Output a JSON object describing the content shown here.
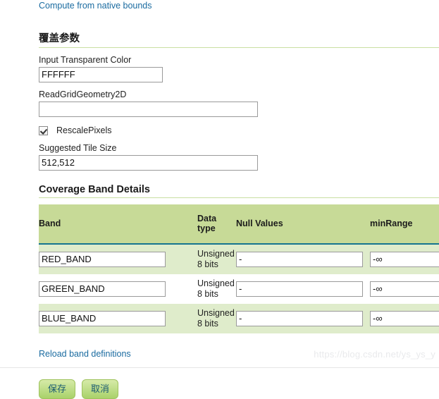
{
  "top_link": "Compute from native bounds",
  "coverage_section": {
    "heading": "覆盖参数",
    "fields": {
      "transparent_color_label": "Input Transparent Color",
      "transparent_color_value": "FFFFFF",
      "readgrid_label": "ReadGridGeometry2D",
      "readgrid_value": "",
      "rescale_label": "RescalePixels",
      "rescale_checked": true,
      "tile_size_label": "Suggested Tile Size",
      "tile_size_value": "512,512"
    }
  },
  "band_section": {
    "heading": "Coverage Band Details",
    "columns": {
      "band": "Band",
      "data_type": "Data\ntype",
      "data_type_line1": "Data",
      "data_type_line2": "type",
      "null_values": "Null Values",
      "min_range": "minRange"
    },
    "rows": [
      {
        "band_name": "RED_BAND",
        "data_type_line1": "Unsigned",
        "data_type_line2": "8 bits",
        "null_values": "-",
        "min_range": "-∞"
      },
      {
        "band_name": "GREEN_BAND",
        "data_type_line1": "Unsigned",
        "data_type_line2": "8 bits",
        "null_values": "-",
        "min_range": "-∞"
      },
      {
        "band_name": "BLUE_BAND",
        "data_type_line1": "Unsigned",
        "data_type_line2": "8 bits",
        "null_values": "-",
        "min_range": "-∞"
      }
    ],
    "reload_link": "Reload band definitions"
  },
  "buttons": {
    "save": "保存",
    "cancel": "取消"
  },
  "watermark": "https://blog.csdn.net/ys_ys_y",
  "colors": {
    "link": "#1a6ba0",
    "header_bg": "#c7da97",
    "header_border": "#15758f",
    "row_odd": "#dfeccb",
    "heading_underline": "#c9dfa2",
    "button_text": "#1a5a72"
  }
}
